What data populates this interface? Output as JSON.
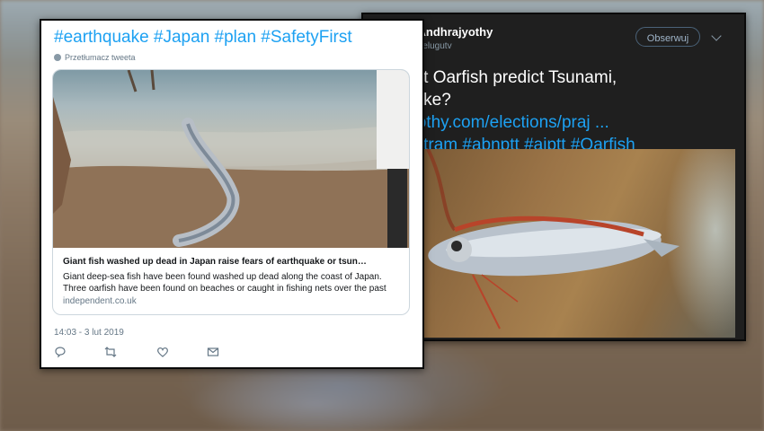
{
  "right_tweet": {
    "author_name": "N Andhrajyothy",
    "author_handle": "ntelugutv",
    "follow_label": "Obserwuj",
    "text_line1": "ant Oarfish predict Tsunami,",
    "text_line2": "uake?",
    "link_text": "jyothy.com/elections/praj ...",
    "hashtags": "antram #abnptt #ajptt #Oarfish",
    "icons": [
      "chevron-down-icon"
    ]
  },
  "left_tweet": {
    "hashtags": "#earthquake #Japan #plan #SafetyFirst",
    "translate_label": "Przetłumacz tweeta",
    "link_card": {
      "title": "Giant fish washed up dead in Japan raise fears of earthquake or tsun…",
      "description": "Giant deep-sea fish have been found washed up dead along the coast of Japan. Three oarfish have been found on beaches or caught in fishing nets over the past",
      "domain": "independent.co.uk"
    },
    "timestamp": "14:03 - 3 lut 2019",
    "icons": [
      "globe-icon",
      "reply-icon",
      "retweet-icon",
      "like-icon",
      "dm-icon"
    ]
  },
  "colors": {
    "twitter_blue": "#1da1f2",
    "dark_card": "#1f1f1f",
    "muted_text": "#657786"
  }
}
